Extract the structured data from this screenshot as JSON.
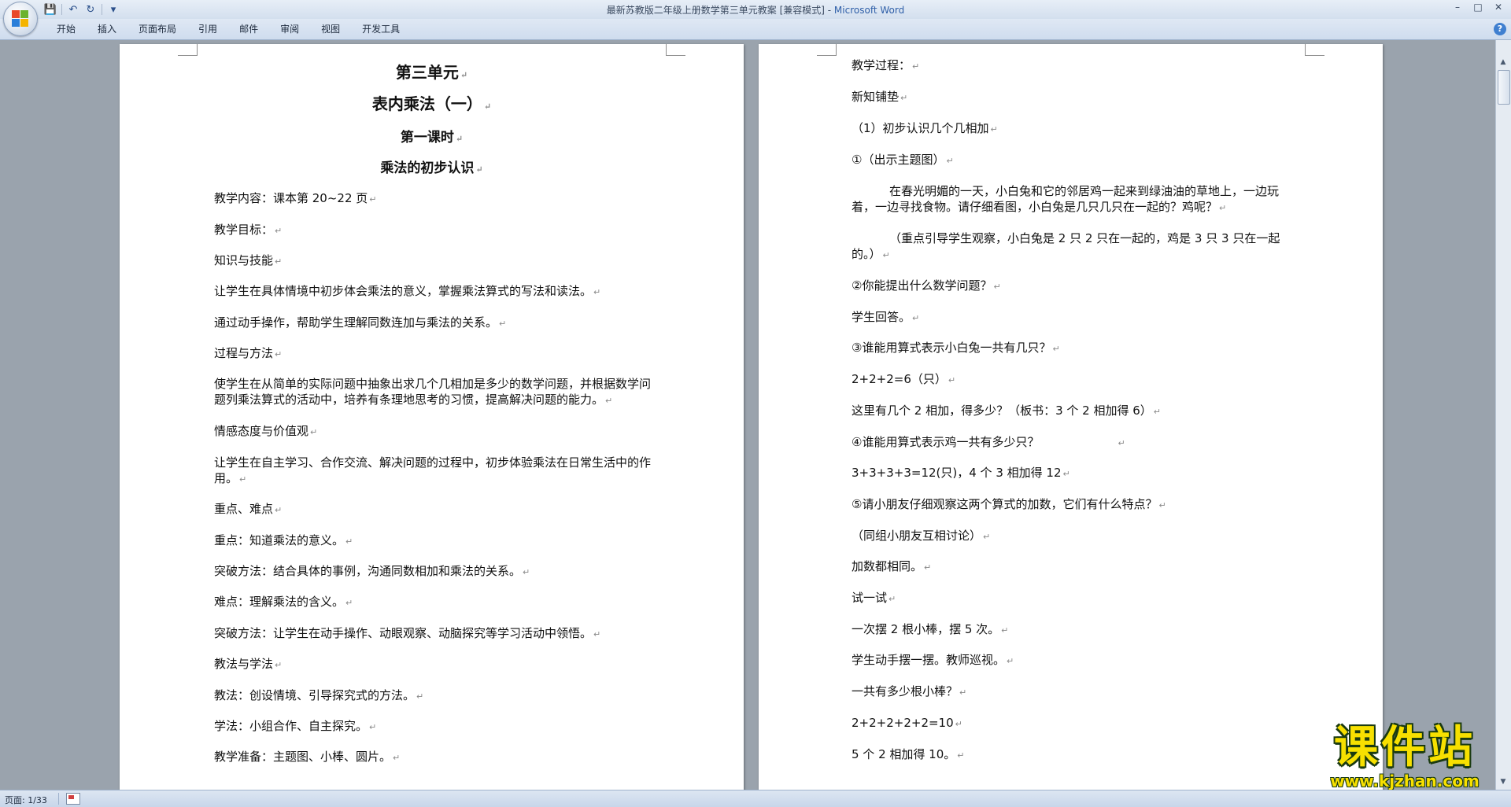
{
  "window": {
    "title": "最新苏教版二年级上册数学第三单元教案 [兼容模式] - ",
    "app_name": "Microsoft Word",
    "controls": [
      "–",
      "□",
      "✕"
    ]
  },
  "qat": {
    "save": "💾",
    "undo": "↶",
    "redo": "↻",
    "more": "▾"
  },
  "ribbon": {
    "tabs": [
      "开始",
      "插入",
      "页面布局",
      "引用",
      "邮件",
      "审阅",
      "视图",
      "开发工具"
    ],
    "help": "?"
  },
  "page_left": {
    "unit_title": "第三单元",
    "chapter_title": "表内乘法（一）",
    "lesson": "第一课时",
    "topic": "乘法的初步认识",
    "paragraphs": [
      "教学内容：课本第 20~22 页",
      "教学目标：",
      "知识与技能",
      "让学生在具体情境中初步体会乘法的意义，掌握乘法算式的写法和读法。",
      "通过动手操作，帮助学生理解同数连加与乘法的关系。",
      "过程与方法",
      "使学生在从简单的实际问题中抽象出求几个几相加是多少的数学问题，并根据数学问题列乘法算式的活动中，培养有条理地思考的习惯，提高解决问题的能力。",
      "情感态度与价值观",
      "让学生在自主学习、合作交流、解决问题的过程中，初步体验乘法在日常生活中的作用。",
      "重点、难点",
      "重点：知道乘法的意义。",
      "突破方法：结合具体的事例，沟通同数相加和乘法的关系。",
      "难点：理解乘法的含义。",
      "突破方法：让学生在动手操作、动眼观察、动脑探究等学习活动中领悟。",
      "教法与学法",
      "教法：创设情境、引导探究式的方法。",
      "学法：小组合作、自主探究。",
      "教学准备：主题图、小棒、圆片。"
    ]
  },
  "page_right": {
    "paragraphs": [
      "教学过程：",
      "新知铺垫",
      "（1）初步认识几个几相加",
      "①（出示主题图）",
      "在春光明媚的一天，小白兔和它的邻居鸡一起来到绿油油的草地上，一边玩着，一边寻找食物。请仔细看图，小白兔是几只几只在一起的？鸡呢？",
      "（重点引导学生观察，小白兔是 2 只 2 只在一起的，鸡是 3 只 3 只在一起的。）",
      "②你能提出什么数学问题？",
      "学生回答。",
      "③谁能用算式表示小白兔一共有几只？",
      "2+2+2=6（只）",
      "这里有几个 2 相加，得多少？（板书：3 个 2 相加得 6）",
      "④谁能用算式表示鸡一共有多少只？",
      "3+3+3+3=12(只)，4 个 3 相加得 12",
      "⑤请小朋友仔细观察这两个算式的加数，它们有什么特点？",
      "（同组小朋友互相讨论）",
      "加数都相同。",
      "试一试",
      "一次摆 2 根小棒，摆 5 次。",
      "学生动手摆一摆。教师巡视。",
      "一共有多少根小棒？",
      "2+2+2+2+2=10",
      "5 个 2 相加得 10。"
    ]
  },
  "paragraph_mark": "↵",
  "status": {
    "page_label": "页面: 1/33"
  },
  "watermark": {
    "title": "课件站",
    "url": "www.kjzhan.com"
  },
  "scroll": {
    "up": "▲",
    "down": "▼"
  }
}
